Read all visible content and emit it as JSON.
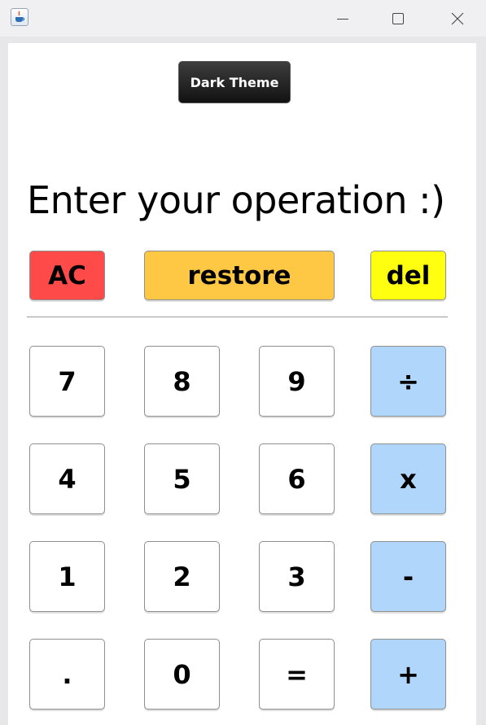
{
  "titlebar": {
    "app_icon": "java-coffee-cup-icon",
    "minimize_icon": "minimize-icon",
    "maximize_icon": "maximize-icon",
    "close_icon": "close-icon"
  },
  "theme_button": {
    "label": "Dark Theme"
  },
  "prompt": {
    "text": "Enter your operation :)"
  },
  "controls": {
    "ac": "AC",
    "restore": "restore",
    "del": "del"
  },
  "keypad": [
    [
      "7",
      "8",
      "9",
      "÷"
    ],
    [
      "4",
      "5",
      "6",
      "x"
    ],
    [
      "1",
      "2",
      "3",
      "-"
    ],
    [
      ".",
      "0",
      "=",
      "+"
    ]
  ],
  "colors": {
    "ac": "#ff4a4a",
    "restore": "#ffc844",
    "del": "#ffff10",
    "operator": "#b0d6fc",
    "theme_button": "#1e1e1e"
  }
}
